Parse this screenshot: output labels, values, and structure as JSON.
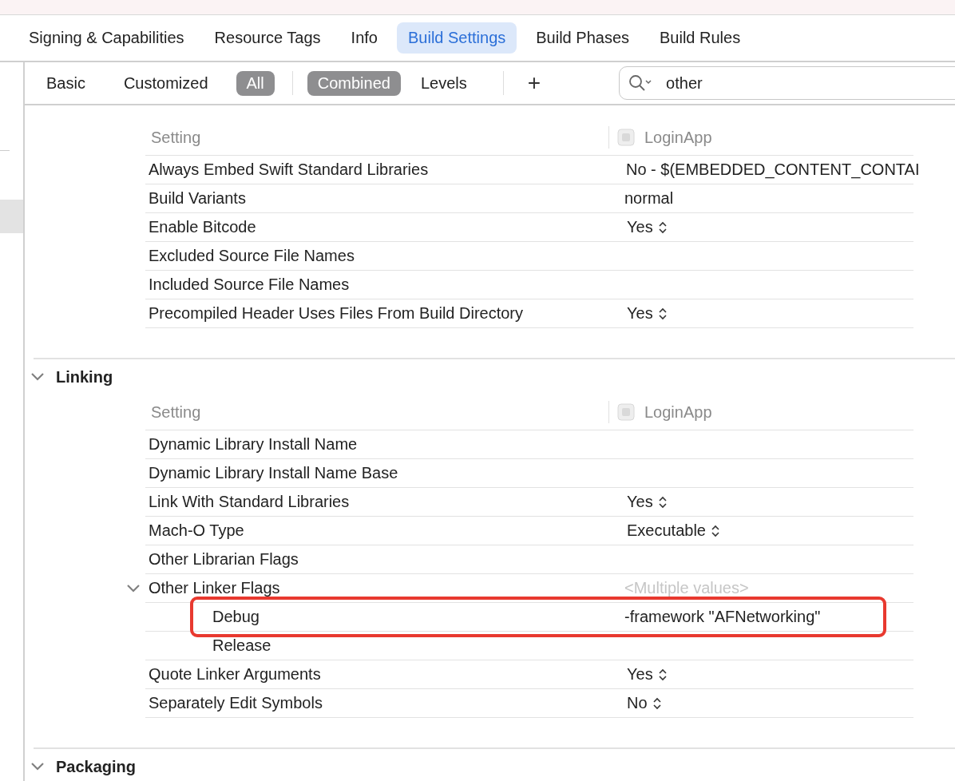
{
  "tabs": [
    {
      "label": "Signing & Capabilities",
      "selected": false
    },
    {
      "label": "Resource Tags",
      "selected": false
    },
    {
      "label": "Info",
      "selected": false
    },
    {
      "label": "Build Settings",
      "selected": true
    },
    {
      "label": "Build Phases",
      "selected": false
    },
    {
      "label": "Build Rules",
      "selected": false
    }
  ],
  "filters": [
    {
      "label": "Basic",
      "selected": false
    },
    {
      "label": "Customized",
      "selected": false
    },
    {
      "label": "All",
      "selected": true
    }
  ],
  "view_modes": [
    {
      "label": "Combined",
      "selected": true
    },
    {
      "label": "Levels",
      "selected": false
    }
  ],
  "add_button": "+",
  "search": {
    "value": "other"
  },
  "sections": [
    {
      "columns": [
        "Setting",
        "LoginApp"
      ],
      "rows": [
        {
          "name": "Always Embed Swift Standard Libraries",
          "value": "No  -  $(EMBEDDED_CONTENT_CONTAI",
          "kind": "popup"
        },
        {
          "name": "Build Variants",
          "value": "normal",
          "kind": "text"
        },
        {
          "name": "Enable Bitcode",
          "value": "Yes",
          "kind": "stepper"
        },
        {
          "name": "Excluded Source File Names"
        },
        {
          "name": "Included Source File Names"
        },
        {
          "name": "Precompiled Header Uses Files From Build Directory",
          "value": "Yes",
          "kind": "stepper"
        }
      ]
    },
    {
      "title": "Linking",
      "expanded": true,
      "columns": [
        "Setting",
        "LoginApp"
      ],
      "rows": [
        {
          "name": "Dynamic Library Install Name"
        },
        {
          "name": "Dynamic Library Install Name Base"
        },
        {
          "name": "Link With Standard Libraries",
          "value": "Yes",
          "kind": "stepper"
        },
        {
          "name": "Mach-O Type",
          "value": "Executable",
          "kind": "stepper"
        },
        {
          "name": "Other Librarian Flags"
        },
        {
          "name": "Other Linker Flags",
          "value": "<Multiple values>",
          "kind": "multiple",
          "expanded": true,
          "children": [
            {
              "name": "Debug",
              "value": "-framework \"AFNetworking\"",
              "kind": "text",
              "highlighted": true
            },
            {
              "name": "Release",
              "highlighted": false
            }
          ]
        },
        {
          "name": "Quote Linker Arguments",
          "value": "Yes",
          "kind": "stepper"
        },
        {
          "name": "Separately Edit Symbols",
          "value": "No",
          "kind": "stepper"
        }
      ]
    },
    {
      "title": "Packaging",
      "expanded": true
    }
  ]
}
